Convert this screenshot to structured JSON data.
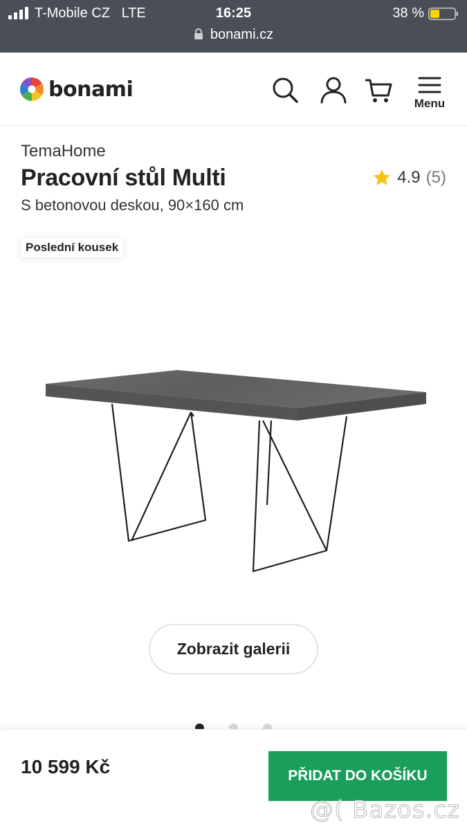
{
  "status_bar": {
    "carrier": "T-Mobile CZ",
    "network": "LTE",
    "time": "16:25",
    "battery_percent": "38 %",
    "url": "bonami.cz"
  },
  "header": {
    "logo_text": "bonami",
    "menu_label": "Menu",
    "icons": [
      "search-icon",
      "user-icon",
      "cart-icon",
      "hamburger-icon"
    ]
  },
  "product": {
    "brand": "TemaHome",
    "title": "Pracovní stůl Multi",
    "subtitle": "S betonovou deskou, 90×160 cm",
    "rating": "4.9",
    "rating_count": "(5)",
    "badge": "Poslední kousek",
    "gallery_button": "Zobrazit galerii",
    "gallery_dots": {
      "total": 3,
      "active": 0
    }
  },
  "bottom_bar": {
    "price": "10 599 Kč",
    "add_to_cart": "PŘIDAT DO KOŠÍKU"
  },
  "watermark": "@( Bazos.cz",
  "colors": {
    "status_bar_bg": "#4a4f57",
    "accent_green": "#1a9e5a",
    "star": "#f5c518",
    "battery": "#f5d30a"
  }
}
